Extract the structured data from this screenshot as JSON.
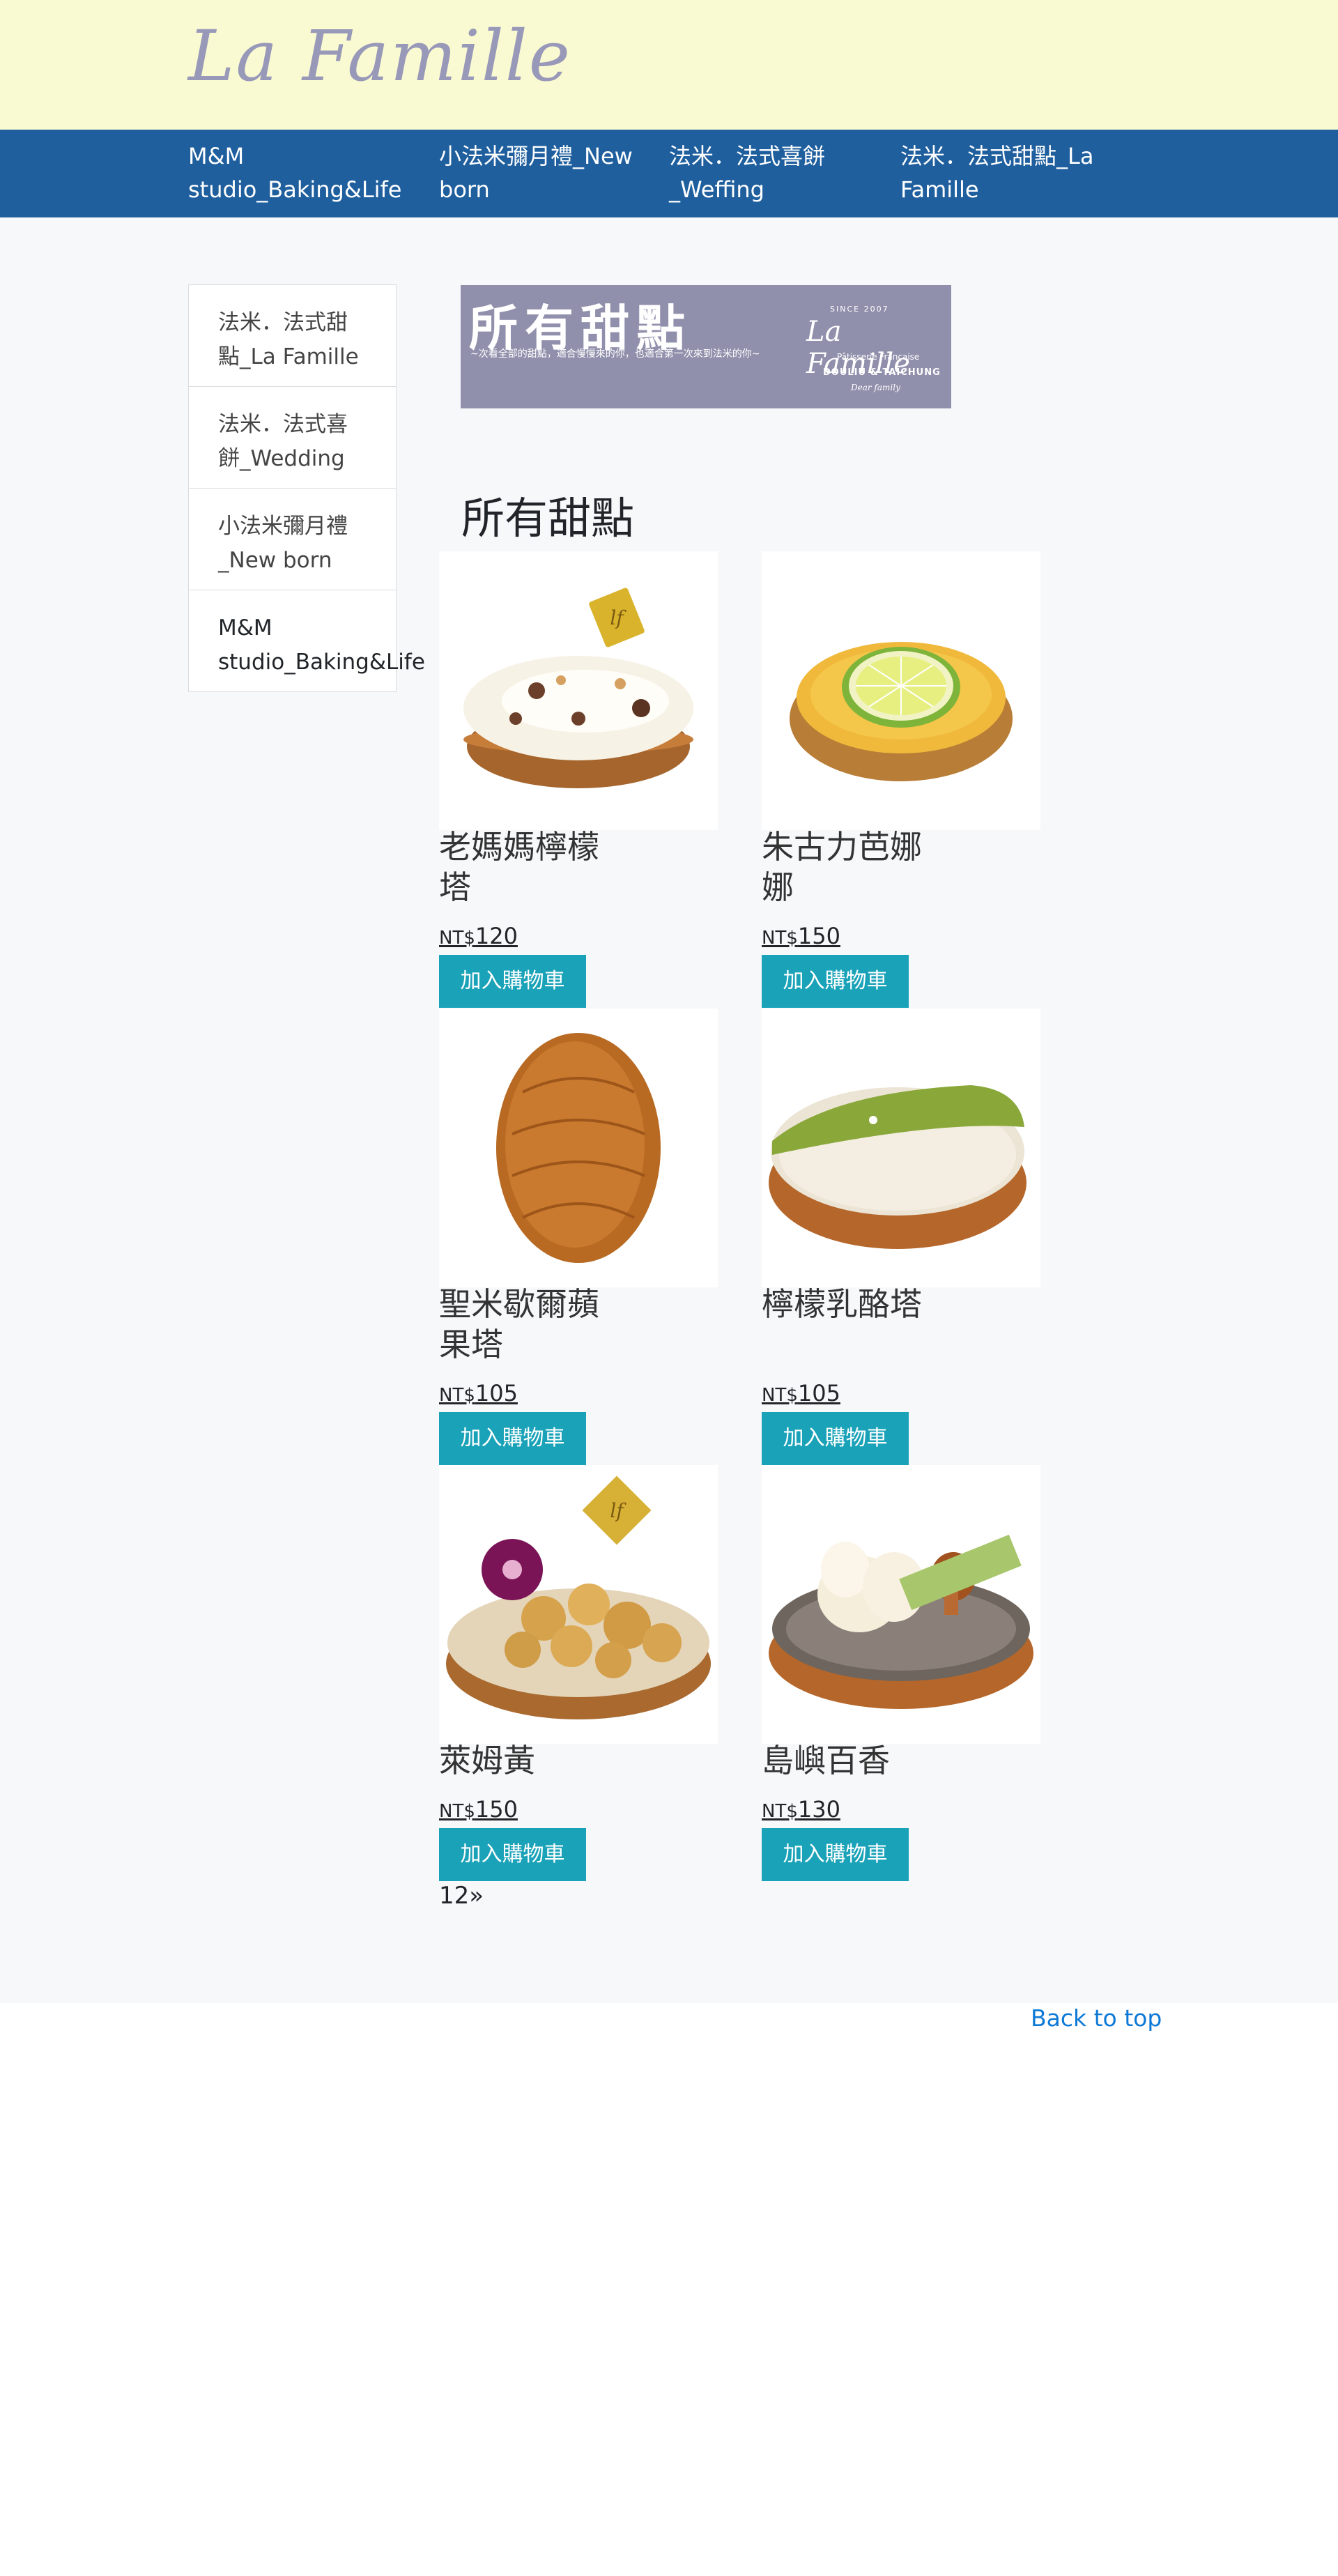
{
  "header": {
    "logo": "La Famille"
  },
  "nav": {
    "items": [
      {
        "label": "M&M studio_Baking&Life"
      },
      {
        "label": "小法米彌月禮_New born"
      },
      {
        "label": "法米．法式喜餅_Weffing"
      },
      {
        "label": "法米．法式甜點_La Famille"
      }
    ]
  },
  "sidebar": {
    "items": [
      {
        "label": "法米．法式甜點_La Famille"
      },
      {
        "label": "法米．法式喜餅_Wedding"
      },
      {
        "label": "小法米彌月禮_New born"
      },
      {
        "label": "M&M studio_Baking&Life"
      }
    ]
  },
  "banner": {
    "title": "所有甜點",
    "subtitle": "~次看全部的甜點，適合慢慢來的你，也適合第一次來到法米的你~",
    "since": "SINCE    2007",
    "logo": "La Famille",
    "patisserie": "Pâtisserie Française",
    "location": "DOULIU & TAICHUNG",
    "dear": "Dear family"
  },
  "section_title": "所有甜點",
  "currency": "NT$",
  "cart_label": "加入購物車",
  "products": [
    {
      "name": "老媽媽檸檬塔",
      "price": "120",
      "image": "lemon-meringue-tart"
    },
    {
      "name": "朱古力芭娜娜",
      "price": "150",
      "image": "lime-tart"
    },
    {
      "name": "聖米歇爾蘋果塔",
      "price": "105",
      "image": "madeleine"
    },
    {
      "name": "檸檬乳酪塔",
      "price": "105",
      "image": "matcha-tart"
    },
    {
      "name": "萊姆黃",
      "price": "150",
      "image": "chestnut-flower-tart"
    },
    {
      "name": "島嶼百香",
      "price": "130",
      "image": "cream-mushroom-tart"
    }
  ],
  "pagination": {
    "text": "12»"
  },
  "footer": {
    "back_to_top": "Back to top"
  },
  "colors": {
    "header_bg": "#fafad2",
    "nav_bg": "#1f5f9e",
    "button": "#1aa2b8",
    "link": "#0d79d6"
  }
}
